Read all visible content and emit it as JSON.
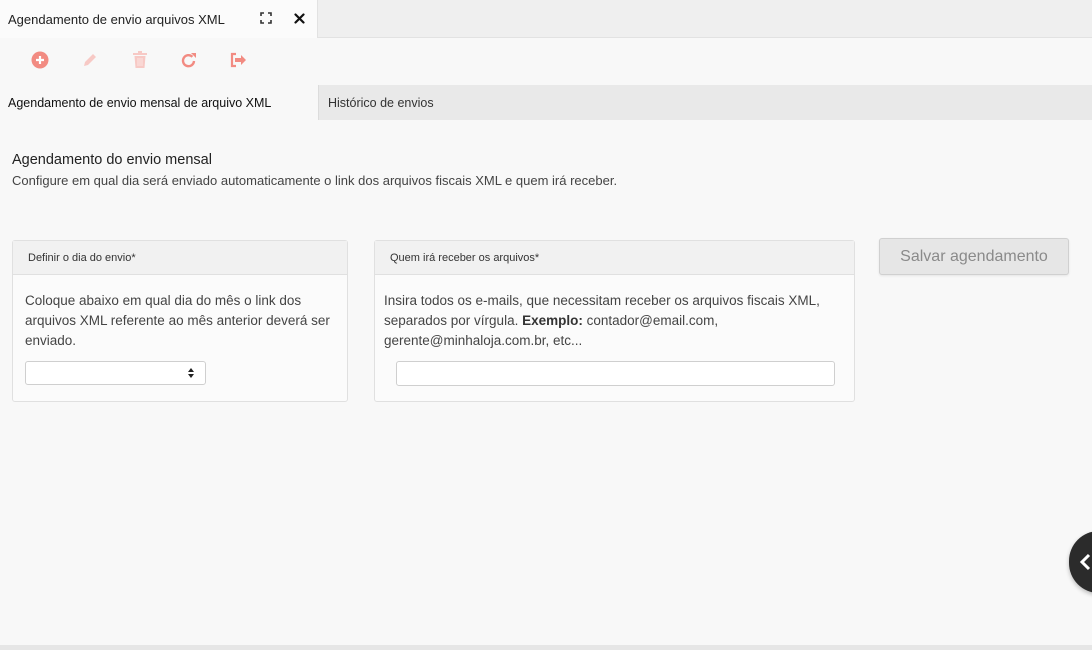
{
  "window": {
    "tab_title": "Agendamento de envio arquivos XML",
    "expand_icon": "expand-icon",
    "close_icon": "close-icon"
  },
  "toolbar": {
    "accent_color": "#f28b82",
    "disabled_color": "#f7c9c5",
    "items": [
      {
        "name": "add",
        "icon": "plus-circle-icon",
        "enabled": true
      },
      {
        "name": "edit",
        "icon": "pencil-icon",
        "enabled": false
      },
      {
        "name": "delete",
        "icon": "trash-icon",
        "enabled": false
      },
      {
        "name": "refresh",
        "icon": "refresh-icon",
        "enabled": true
      },
      {
        "name": "exit",
        "icon": "sign-out-icon",
        "enabled": true
      }
    ]
  },
  "subtabs": [
    {
      "label": "Agendamento de envio mensal de arquivo XML",
      "active": true
    },
    {
      "label": "Histórico de envios",
      "active": false
    }
  ],
  "section": {
    "title": "Agendamento do envio mensal",
    "description": "Configure em qual dia será enviado automaticamente o link dos arquivos fiscais XML e quem irá receber."
  },
  "day_panel": {
    "header": "Definir o dia do envio*",
    "text": "Coloque abaixo em qual dia do mês o link dos arquivos XML referente ao mês anterior deverá ser enviado.",
    "select_value": ""
  },
  "email_panel": {
    "header": "Quem irá receber os arquivos*",
    "text_before": "Insira todos os e-mails, que necessitam receber os arquivos fiscais XML, separados por vírgula. ",
    "example_label": "Exemplo:",
    "text_after": " contador@email.com, gerente@minhaloja.com.br, etc...",
    "input_value": "",
    "input_placeholder": ""
  },
  "save_button": {
    "label": "Salvar agendamento"
  },
  "side_toggle": {
    "icon": "chevron-left-icon"
  }
}
